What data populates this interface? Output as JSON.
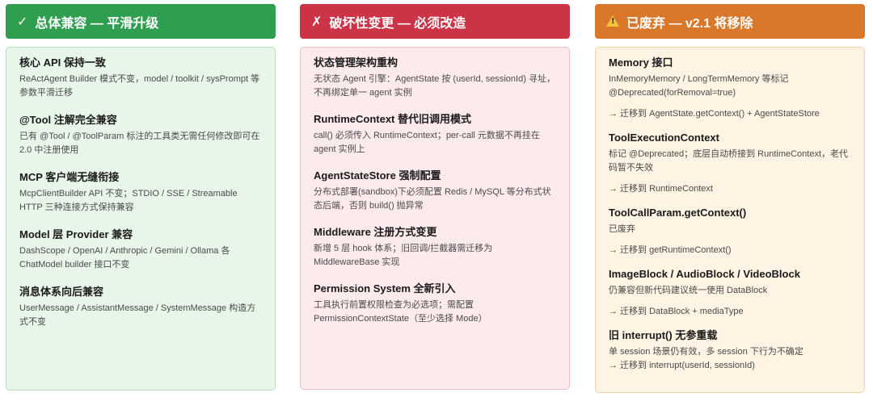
{
  "columns": {
    "compatible": {
      "title": "总体兼容 — 平滑升级",
      "icon": "check-icon",
      "accent": "#2f9e4f",
      "items": [
        {
          "title": "核心 API 保持一致",
          "desc": "ReActAgent Builder 模式不变，model / toolkit / sysPrompt 等参数平滑迁移"
        },
        {
          "title": "@Tool 注解完全兼容",
          "desc": "已有 @Tool / @ToolParam 标注的工具类无需任何修改即可在 2.0 中注册使用"
        },
        {
          "title": "MCP 客户端无缝衔接",
          "desc": "McpClientBuilder API 不变；STDIO / SSE / Streamable HTTP 三种连接方式保持兼容"
        },
        {
          "title": "Model 层 Provider 兼容",
          "desc": "DashScope / OpenAI / Anthropic / Gemini / Ollama 各 ChatModel builder 接口不变"
        },
        {
          "title": "消息体系向后兼容",
          "desc": "UserMessage / AssistantMessage / SystemMessage 构造方式不变"
        }
      ]
    },
    "breaking": {
      "title": "破坏性变更 — 必须改造",
      "icon": "cross-icon",
      "accent": "#cc3347",
      "items": [
        {
          "title": "状态管理架构重构",
          "desc": "无状态 Agent 引擎：AgentState 按 (userId, sessionId) 寻址，不再绑定单一 agent 实例"
        },
        {
          "title": "RuntimeContext 替代旧调用模式",
          "desc": "call() 必须传入 RuntimeContext；per-call 元数据不再挂在 agent 实例上"
        },
        {
          "title": "AgentStateStore 强制配置",
          "desc": "分布式部署(sandbox)下必须配置 Redis / MySQL 等分布式状态后端，否则 build() 抛异常"
        },
        {
          "title": "Middleware 注册方式变更",
          "desc": "新增 5 层 hook 体系；旧回调/拦截器需迁移为 MiddlewareBase 实现"
        },
        {
          "title": "Permission System 全新引入",
          "desc": "工具执行前置权限检查为必选项；需配置 PermissionContextState（至少选择 Mode）"
        }
      ]
    },
    "deprecated": {
      "title": "已废弃 — v2.1 将移除",
      "icon": "warning-icon",
      "accent": "#d9782a",
      "items": [
        {
          "title": "Memory 接口",
          "desc": "InMemoryMemory / LongTermMemory 等标记 @Deprecated(forRemoval=true)",
          "migrate": "→ 迁移到 AgentState.getContext() + AgentStateStore"
        },
        {
          "title": "ToolExecutionContext",
          "desc": "标记 @Deprecated；底层自动桥接到 RuntimeContext，老代码暂不失效",
          "migrate": "→ 迁移到 RuntimeContext"
        },
        {
          "title": "ToolCallParam.getContext()",
          "desc": "已废弃",
          "migrate": "→ 迁移到 getRuntimeContext()"
        },
        {
          "title": "ImageBlock / AudioBlock / VideoBlock",
          "desc": "仍兼容但新代码建议统一使用 DataBlock",
          "migrate": "→ 迁移到 DataBlock + mediaType"
        },
        {
          "title": "旧 interrupt() 无参重载",
          "desc": "单 session 场景仍有效，多 session 下行为不确定",
          "migrate": "→ 迁移到 interrupt(userId, sessionId)"
        }
      ]
    }
  }
}
